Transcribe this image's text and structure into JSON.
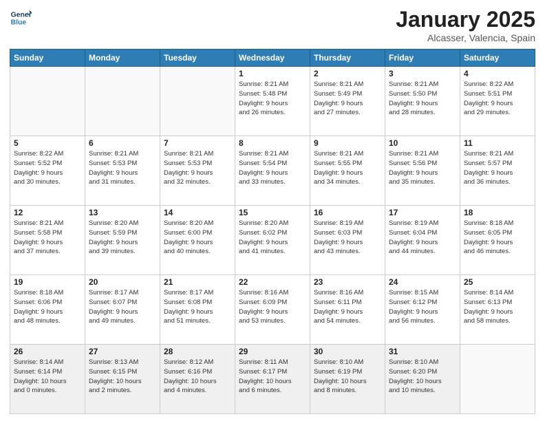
{
  "header": {
    "logo_line1": "General",
    "logo_line2": "Blue",
    "title": "January 2025",
    "subtitle": "Alcasser, Valencia, Spain"
  },
  "columns": [
    "Sunday",
    "Monday",
    "Tuesday",
    "Wednesday",
    "Thursday",
    "Friday",
    "Saturday"
  ],
  "weeks": [
    [
      {
        "day": "",
        "info": ""
      },
      {
        "day": "",
        "info": ""
      },
      {
        "day": "",
        "info": ""
      },
      {
        "day": "1",
        "info": "Sunrise: 8:21 AM\nSunset: 5:48 PM\nDaylight: 9 hours\nand 26 minutes."
      },
      {
        "day": "2",
        "info": "Sunrise: 8:21 AM\nSunset: 5:49 PM\nDaylight: 9 hours\nand 27 minutes."
      },
      {
        "day": "3",
        "info": "Sunrise: 8:21 AM\nSunset: 5:50 PM\nDaylight: 9 hours\nand 28 minutes."
      },
      {
        "day": "4",
        "info": "Sunrise: 8:22 AM\nSunset: 5:51 PM\nDaylight: 9 hours\nand 29 minutes."
      }
    ],
    [
      {
        "day": "5",
        "info": "Sunrise: 8:22 AM\nSunset: 5:52 PM\nDaylight: 9 hours\nand 30 minutes."
      },
      {
        "day": "6",
        "info": "Sunrise: 8:21 AM\nSunset: 5:53 PM\nDaylight: 9 hours\nand 31 minutes."
      },
      {
        "day": "7",
        "info": "Sunrise: 8:21 AM\nSunset: 5:53 PM\nDaylight: 9 hours\nand 32 minutes."
      },
      {
        "day": "8",
        "info": "Sunrise: 8:21 AM\nSunset: 5:54 PM\nDaylight: 9 hours\nand 33 minutes."
      },
      {
        "day": "9",
        "info": "Sunrise: 8:21 AM\nSunset: 5:55 PM\nDaylight: 9 hours\nand 34 minutes."
      },
      {
        "day": "10",
        "info": "Sunrise: 8:21 AM\nSunset: 5:56 PM\nDaylight: 9 hours\nand 35 minutes."
      },
      {
        "day": "11",
        "info": "Sunrise: 8:21 AM\nSunset: 5:57 PM\nDaylight: 9 hours\nand 36 minutes."
      }
    ],
    [
      {
        "day": "12",
        "info": "Sunrise: 8:21 AM\nSunset: 5:58 PM\nDaylight: 9 hours\nand 37 minutes."
      },
      {
        "day": "13",
        "info": "Sunrise: 8:20 AM\nSunset: 5:59 PM\nDaylight: 9 hours\nand 39 minutes."
      },
      {
        "day": "14",
        "info": "Sunrise: 8:20 AM\nSunset: 6:00 PM\nDaylight: 9 hours\nand 40 minutes."
      },
      {
        "day": "15",
        "info": "Sunrise: 8:20 AM\nSunset: 6:02 PM\nDaylight: 9 hours\nand 41 minutes."
      },
      {
        "day": "16",
        "info": "Sunrise: 8:19 AM\nSunset: 6:03 PM\nDaylight: 9 hours\nand 43 minutes."
      },
      {
        "day": "17",
        "info": "Sunrise: 8:19 AM\nSunset: 6:04 PM\nDaylight: 9 hours\nand 44 minutes."
      },
      {
        "day": "18",
        "info": "Sunrise: 8:18 AM\nSunset: 6:05 PM\nDaylight: 9 hours\nand 46 minutes."
      }
    ],
    [
      {
        "day": "19",
        "info": "Sunrise: 8:18 AM\nSunset: 6:06 PM\nDaylight: 9 hours\nand 48 minutes."
      },
      {
        "day": "20",
        "info": "Sunrise: 8:17 AM\nSunset: 6:07 PM\nDaylight: 9 hours\nand 49 minutes."
      },
      {
        "day": "21",
        "info": "Sunrise: 8:17 AM\nSunset: 6:08 PM\nDaylight: 9 hours\nand 51 minutes."
      },
      {
        "day": "22",
        "info": "Sunrise: 8:16 AM\nSunset: 6:09 PM\nDaylight: 9 hours\nand 53 minutes."
      },
      {
        "day": "23",
        "info": "Sunrise: 8:16 AM\nSunset: 6:11 PM\nDaylight: 9 hours\nand 54 minutes."
      },
      {
        "day": "24",
        "info": "Sunrise: 8:15 AM\nSunset: 6:12 PM\nDaylight: 9 hours\nand 56 minutes."
      },
      {
        "day": "25",
        "info": "Sunrise: 8:14 AM\nSunset: 6:13 PM\nDaylight: 9 hours\nand 58 minutes."
      }
    ],
    [
      {
        "day": "26",
        "info": "Sunrise: 8:14 AM\nSunset: 6:14 PM\nDaylight: 10 hours\nand 0 minutes."
      },
      {
        "day": "27",
        "info": "Sunrise: 8:13 AM\nSunset: 6:15 PM\nDaylight: 10 hours\nand 2 minutes."
      },
      {
        "day": "28",
        "info": "Sunrise: 8:12 AM\nSunset: 6:16 PM\nDaylight: 10 hours\nand 4 minutes."
      },
      {
        "day": "29",
        "info": "Sunrise: 8:11 AM\nSunset: 6:17 PM\nDaylight: 10 hours\nand 6 minutes."
      },
      {
        "day": "30",
        "info": "Sunrise: 8:10 AM\nSunset: 6:19 PM\nDaylight: 10 hours\nand 8 minutes."
      },
      {
        "day": "31",
        "info": "Sunrise: 8:10 AM\nSunset: 6:20 PM\nDaylight: 10 hours\nand 10 minutes."
      },
      {
        "day": "",
        "info": ""
      }
    ]
  ]
}
